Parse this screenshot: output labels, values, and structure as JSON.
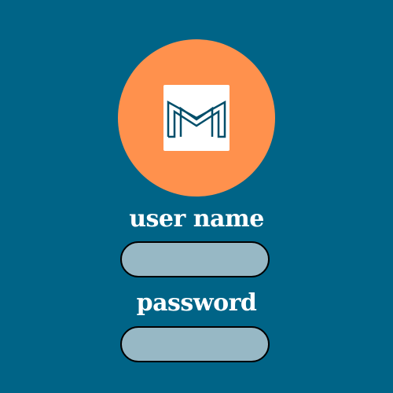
{
  "logo": {
    "icon": "monogram-m-logo",
    "circle_color": "#FF914D",
    "mark_color": "#004E6A"
  },
  "form": {
    "username_label": "user name",
    "username_value": "",
    "password_label": "password",
    "password_value": ""
  },
  "colors": {
    "background": "#006487",
    "field_fill": "#97B8C5",
    "field_border": "#000000",
    "label_text": "#FFFFFF"
  }
}
